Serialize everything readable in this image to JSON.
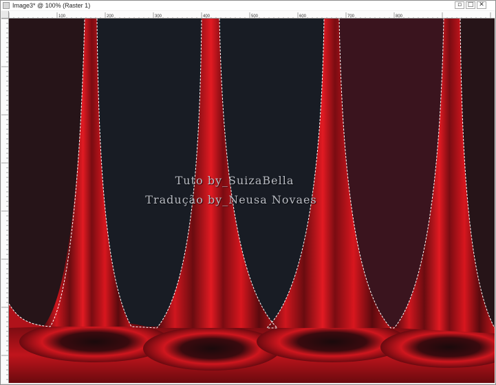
{
  "window": {
    "title": "Image3* @ 100% (Raster 1)",
    "buttons": {
      "restore": "▫",
      "maximize": "□",
      "close": "✕"
    }
  },
  "ruler": {
    "top_labels": [
      "100",
      "200",
      "300",
      "400",
      "500",
      "600",
      "700",
      "800"
    ]
  },
  "canvas": {
    "watermark_line1": "Tuto by_SuizaBella",
    "watermark_line2": "Tradução by_Neusa Novaes",
    "colors": {
      "background_dark": "#181c24",
      "panel_maroon": "#3a141e",
      "panel_dark_maroon": "#261418",
      "curtain_red": "#c8141c",
      "curtain_dark": "#5a0a0e"
    }
  }
}
